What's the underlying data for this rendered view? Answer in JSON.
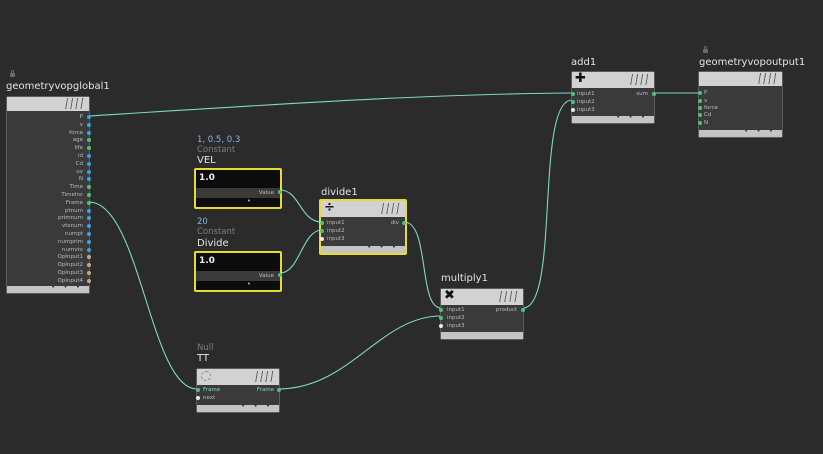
{
  "colors": {
    "background": "#2b2b2b",
    "wire": "#7fd9c2",
    "selected": "#e8dc32",
    "port_vector": "#2ea8e0",
    "port_float": "#4fc27a",
    "port_int": "#e9e9e9",
    "port_string": "#c8a882"
  },
  "nodes": {
    "global": {
      "name": "geometryvopglobal1",
      "outputs": [
        "P",
        "v",
        "force",
        "age",
        "life",
        "id",
        "Cd",
        "uv",
        "N",
        "Time",
        "TimeInc",
        "Frame",
        "ptnum",
        "primnum",
        "vtxnum",
        "numpt",
        "numprim",
        "numvtx",
        "OpInput1",
        "OpInput2",
        "OpInput3",
        "OpInput4"
      ]
    },
    "vel": {
      "value_label": "1, 0.5, 0.3",
      "type_label": "Constant",
      "name": "VEL",
      "icon": "1.0",
      "output": "Value"
    },
    "divconst": {
      "value_label": "20",
      "type_label": "Constant",
      "name": "Divide",
      "icon": "1.0",
      "output": "Value"
    },
    "divide1": {
      "name": "divide1",
      "icon": "÷",
      "inputs": [
        "input1",
        "input2",
        "input3"
      ],
      "output": "div"
    },
    "multiply1": {
      "name": "multiply1",
      "icon": "✖",
      "inputs": [
        "input1",
        "input2",
        "input3"
      ],
      "output": "product"
    },
    "add1": {
      "name": "add1",
      "icon": "✚",
      "inputs": [
        "input1",
        "input2",
        "input3"
      ],
      "output": "sum"
    },
    "tt": {
      "type_label": "Null",
      "name": "TT",
      "inputs": [
        "Frame",
        "next"
      ],
      "output": "Frame"
    },
    "output": {
      "name": "geometryvopoutput1",
      "inputs": [
        "P",
        "v",
        "force",
        "Cd",
        "N"
      ]
    }
  }
}
